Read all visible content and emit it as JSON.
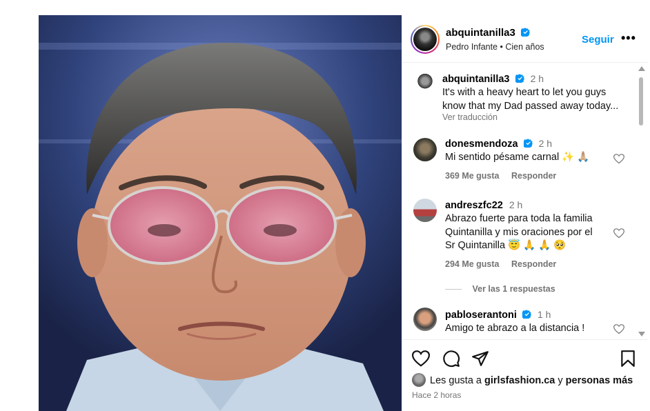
{
  "post_author": {
    "username": "abquintanilla3",
    "subtitle": "Pedro Infante • Cien años",
    "follow_label": "Seguir",
    "more_label": "•••"
  },
  "caption": {
    "username": "abquintanilla3",
    "time": "2 h",
    "text_line1": "It's with a heavy heart to let you guys",
    "text_line2": "know that my Dad passed away today...",
    "translate_label": "Ver traducción"
  },
  "comments": [
    {
      "username": "donesmendoza",
      "verified": true,
      "time": "2 h",
      "lines": [
        "Mi sentido pésame carnal ✨ 🙏🏼"
      ],
      "likes": "369 Me gusta",
      "reply_label": "Responder"
    },
    {
      "username": "andreszfc22",
      "verified": false,
      "time": "2 h",
      "lines": [
        "Abrazo fuerte para toda la familia",
        "Quintanilla y mis oraciones por el",
        "Sr Quintanilla 😇 🙏 🙏 🥺"
      ],
      "likes": "294 Me gusta",
      "reply_label": "Responder",
      "view_replies": "Ver las 1 respuestas"
    },
    {
      "username": "pabloserantoni",
      "verified": true,
      "time": "1 h",
      "lines": [
        "Amigo te abrazo a la distancia !"
      ]
    }
  ],
  "likes_summary": {
    "prefix": "Les gusta a",
    "user": "girlsfashion.ca",
    "connector": "y",
    "others": "personas más"
  },
  "timestamp": "Hace 2 horas",
  "icons": {
    "verified": "verified-badge-icon",
    "like": "heart-icon",
    "comment": "comment-icon",
    "share": "share-icon",
    "save": "bookmark-icon"
  },
  "colors": {
    "accent": "#0095f6",
    "muted": "#737373"
  }
}
